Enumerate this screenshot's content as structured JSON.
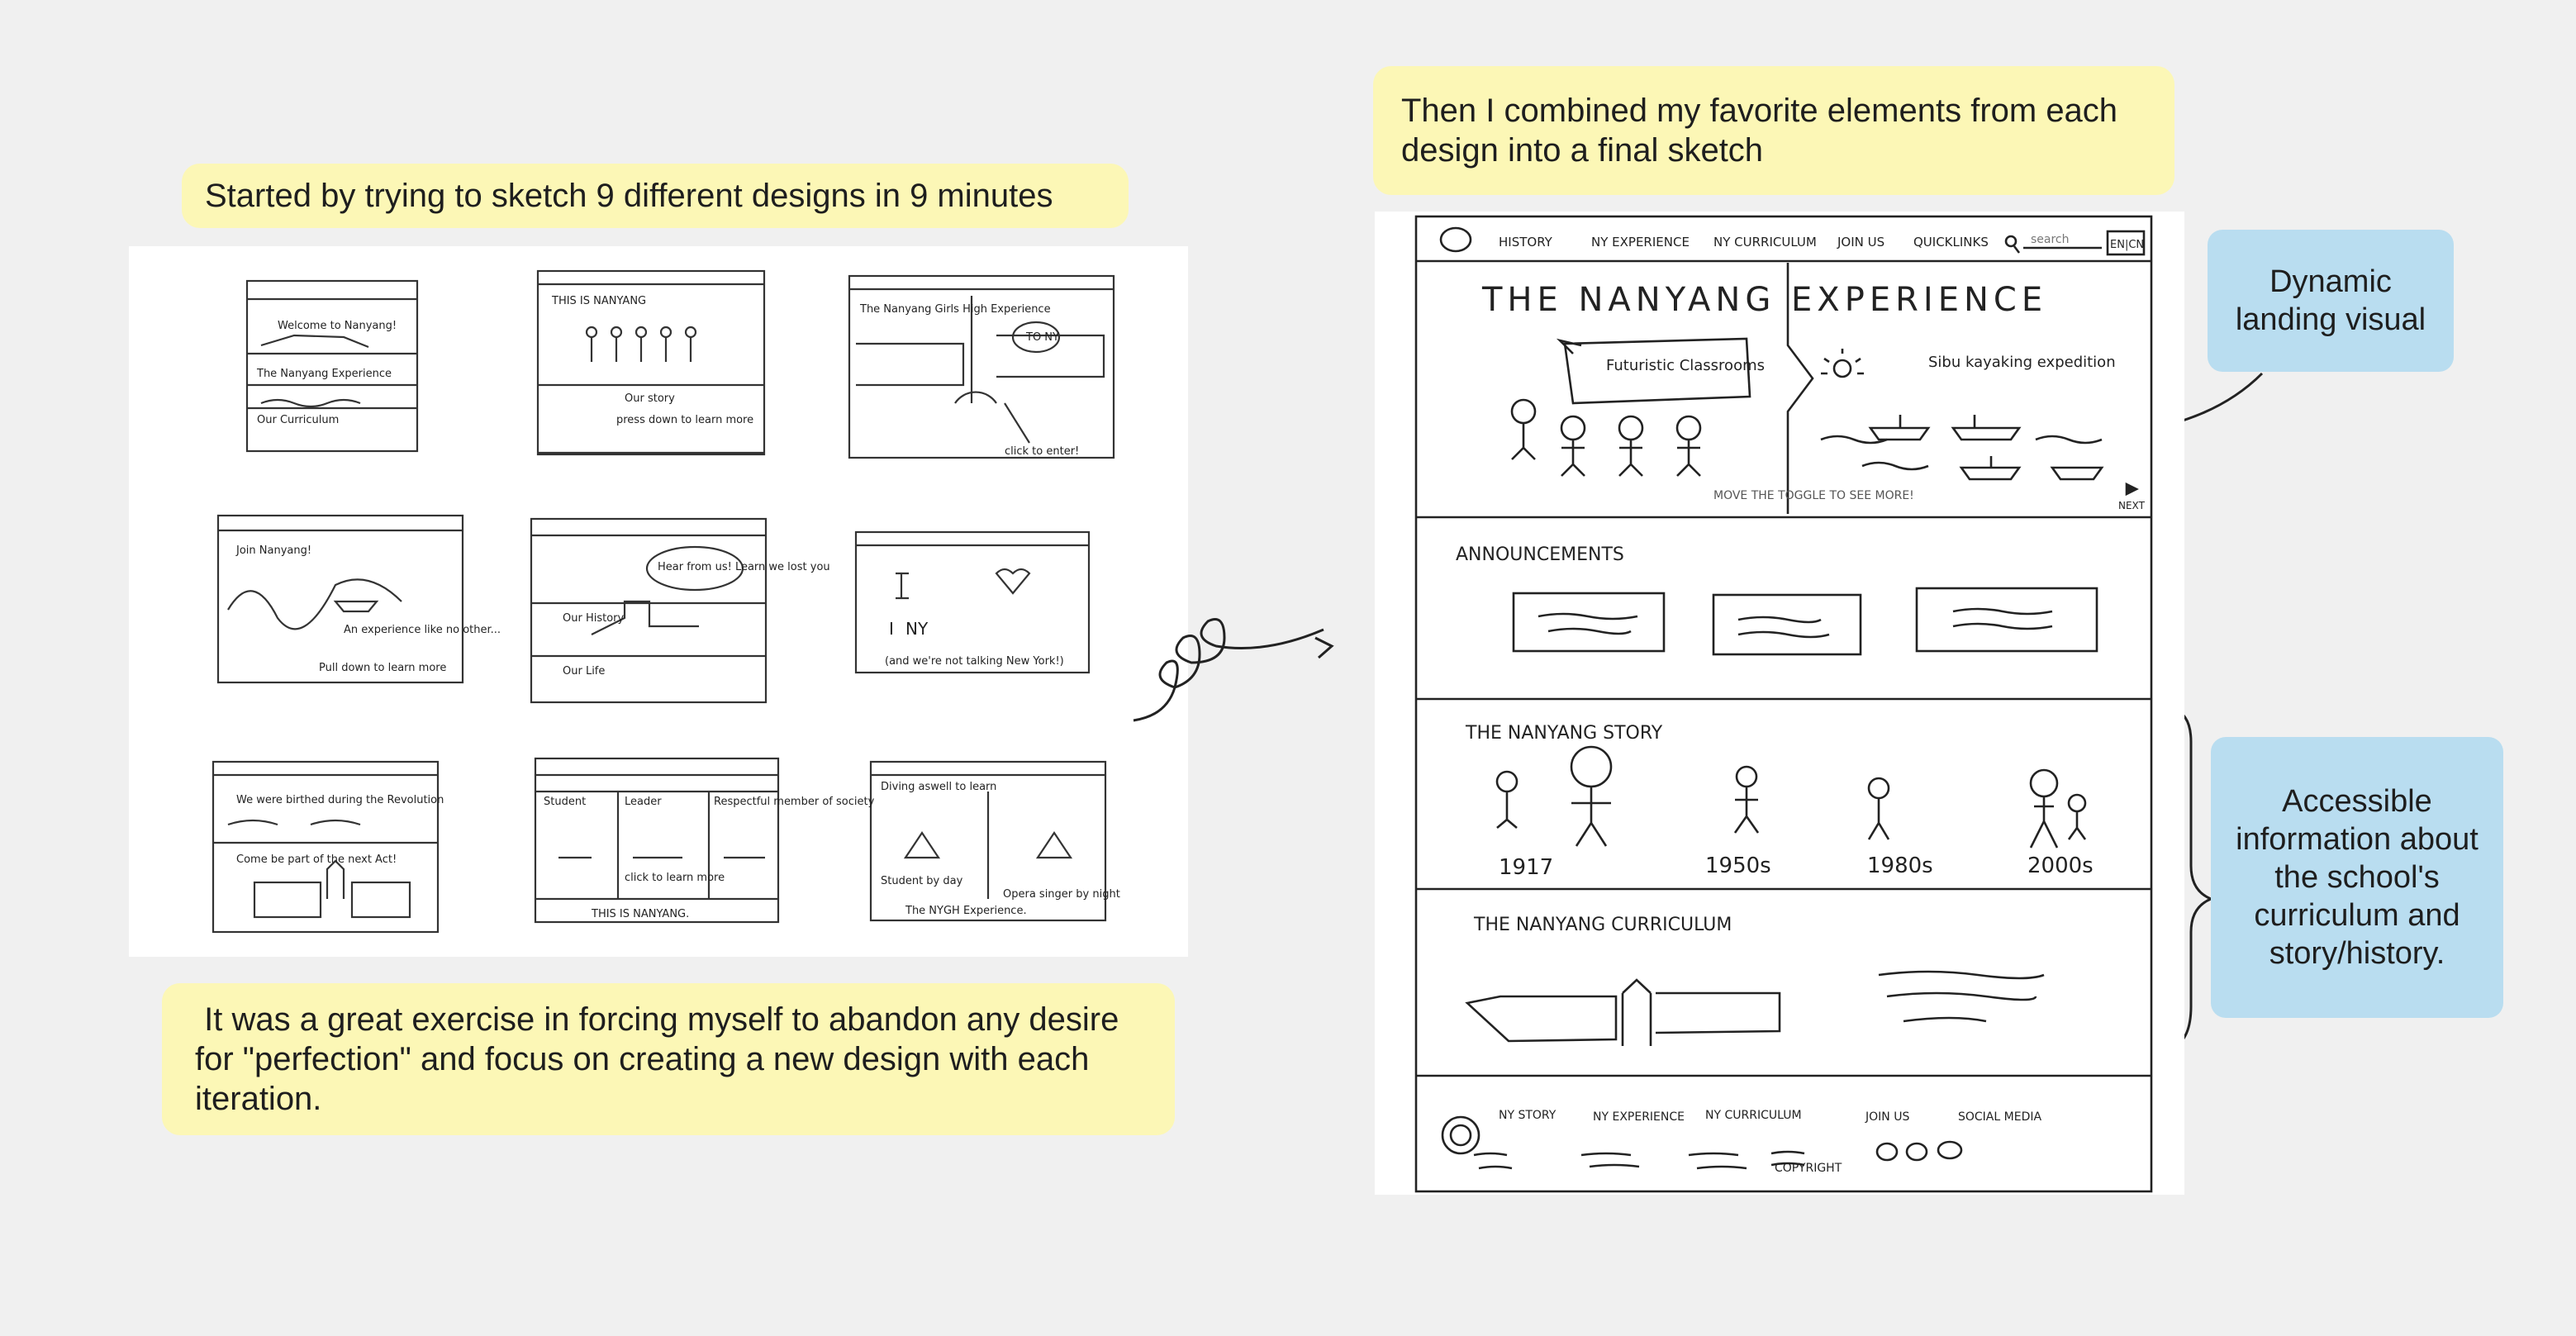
{
  "notes": {
    "intro": "Started by trying to sketch 9 different designs in 9 minutes",
    "reflection": " It was a great exercise in forcing myself to abandon any desire for \"perfection\" and focus on creating a new design with each iteration.",
    "combined": "Then I combined my favorite elements from each design into a final sketch"
  },
  "callouts": {
    "landing": "Dynamic landing visual",
    "accessible": "Accessible information about the school's curriculum and story/history."
  },
  "final_sketch": {
    "nav": [
      "HISTORY",
      "NY EXPERIENCE",
      "NY CURRICULUM",
      "JOIN US",
      "QUICKLINKS"
    ],
    "search_placeholder": "search",
    "lang": "EN|CN",
    "hero_title": "THE    NANYANG  EXPERIENCE",
    "hero_left": "Futuristic Classrooms",
    "hero_right": "Sibu kayaking expedition",
    "toggle_hint": "MOVE THE TOGGLE TO SEE MORE!",
    "next": "NEXT",
    "announcements": "ANNOUNCEMENTS",
    "story_title": "THE NANYANG STORY",
    "years": [
      "1917",
      "1950s",
      "1980s",
      "2000s"
    ],
    "curriculum_title": "THE NANYANG CURRICULUM",
    "footer_links": [
      "NY STORY",
      "NY EXPERIENCE",
      "NY CURRICULUM",
      "JOIN US",
      "SOCIAL MEDIA"
    ],
    "copyright": "COPYRIGHT"
  },
  "thumbs": [
    {
      "lines": [
        "Welcome to Nanyang!",
        "The Nanyang Experience",
        "Our Curriculum"
      ]
    },
    {
      "lines": [
        "THIS IS NANYANG",
        "Our story",
        "press down to learn more"
      ]
    },
    {
      "lines": [
        "The Nanyang Girls High Experience",
        "TO NY",
        "click to enter!"
      ]
    },
    {
      "lines": [
        "Join Nanyang!",
        "An experience like no other...",
        "Pull down to learn more"
      ]
    },
    {
      "lines": [
        "Hear from us! Learn we lost you",
        "Our History",
        "Our Life"
      ]
    },
    {
      "lines": [
        "I",
        "NY",
        "(and we're not talking New York!)"
      ]
    },
    {
      "lines": [
        "We were birthed during the Revolution",
        "Come be part of the next Act!"
      ]
    },
    {
      "lines": [
        "Student",
        "Leader",
        "Respectful member of society",
        "click to learn more",
        "THIS IS NANYANG."
      ]
    },
    {
      "lines": [
        "Diving aswell to learn",
        "Student by day",
        "Opera singer by night",
        "The NYGH Experience."
      ]
    }
  ]
}
